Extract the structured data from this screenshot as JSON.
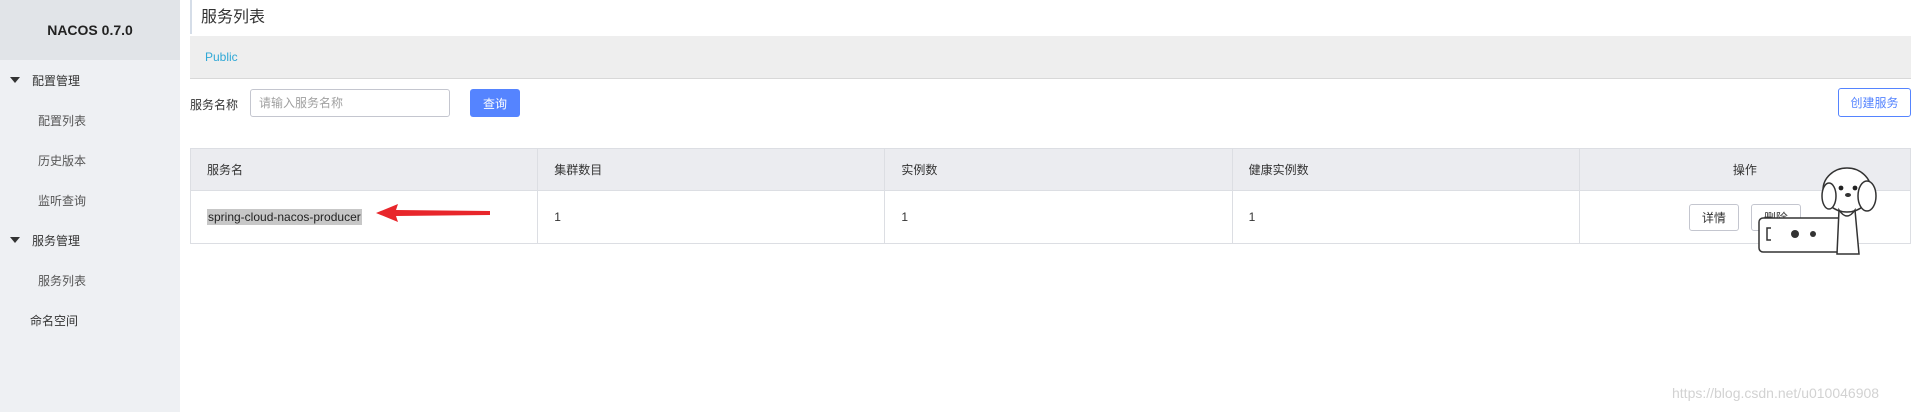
{
  "app": {
    "title": "NACOS 0.7.0"
  },
  "sidebar": {
    "groups": [
      {
        "label": "配置管理",
        "items": [
          "配置列表",
          "历史版本",
          "监听查询"
        ]
      },
      {
        "label": "服务管理",
        "items": [
          "服务列表"
        ]
      }
    ],
    "extra": "命名空间"
  },
  "page": {
    "title": "服务列表"
  },
  "namespace": {
    "active": "Public"
  },
  "filter": {
    "label": "服务名称",
    "placeholder": "请输入服务名称",
    "value": "",
    "query_button": "查询",
    "create_button": "创建服务"
  },
  "table": {
    "headers": [
      "服务名",
      "集群数目",
      "实例数",
      "健康实例数",
      "操作"
    ],
    "rows": [
      {
        "name": "spring-cloud-nacos-producer",
        "clusters": "1",
        "instances": "1",
        "healthy": "1"
      }
    ],
    "actions": {
      "detail": "详情",
      "delete": "删除"
    }
  },
  "watermark": "https://blog.csdn.net/u010046908",
  "colors": {
    "primary": "#5584ff",
    "link": "#2fa8d6",
    "annotation_arrow": "#e8262b",
    "sidebar_bg": "#eef0f3"
  },
  "annotation": "red-arrow-icon"
}
